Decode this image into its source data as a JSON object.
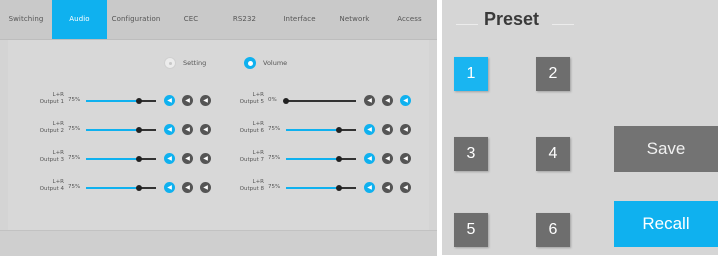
{
  "nav": {
    "tabs": [
      "Switching",
      "Audio",
      "Configuration",
      "CEC",
      "RS232",
      "Interface",
      "Network",
      "Access"
    ],
    "active_tab": "Audio"
  },
  "audio": {
    "modes": {
      "setting_label": "Setting",
      "volume_label": "Volume",
      "selected": "Volume"
    },
    "outputs": [
      {
        "label_line1": "L+R",
        "label_line2": "Output 1",
        "volume": "75%",
        "level": 0.75,
        "active_button": 1
      },
      {
        "label_line1": "L+R",
        "label_line2": "Output 2",
        "volume": "75%",
        "level": 0.75,
        "active_button": 1
      },
      {
        "label_line1": "L+R",
        "label_line2": "Output 3",
        "volume": "75%",
        "level": 0.75,
        "active_button": 1
      },
      {
        "label_line1": "L+R",
        "label_line2": "Output 4",
        "volume": "75%",
        "level": 0.75,
        "active_button": 1
      },
      {
        "label_line1": "L+R",
        "label_line2": "Output 5",
        "volume": "0%",
        "level": 0.0,
        "active_button": 3
      },
      {
        "label_line1": "L+R",
        "label_line2": "Output 6",
        "volume": "75%",
        "level": 0.75,
        "active_button": 1
      },
      {
        "label_line1": "L+R",
        "label_line2": "Output 7",
        "volume": "75%",
        "level": 0.75,
        "active_button": 1
      },
      {
        "label_line1": "L+R",
        "label_line2": "Output 8",
        "volume": "75%",
        "level": 0.75,
        "active_button": 1
      }
    ],
    "button_icon": "speaker-icon"
  },
  "preset": {
    "title": "Preset",
    "buttons": [
      "1",
      "2",
      "3",
      "4",
      "5",
      "6"
    ],
    "selected": "1",
    "save_label": "Save",
    "recall_label": "Recall"
  },
  "colors": {
    "accent": "#0fb1ef",
    "button_dark": "#6e6e6e",
    "background": "#d4d4d4"
  }
}
